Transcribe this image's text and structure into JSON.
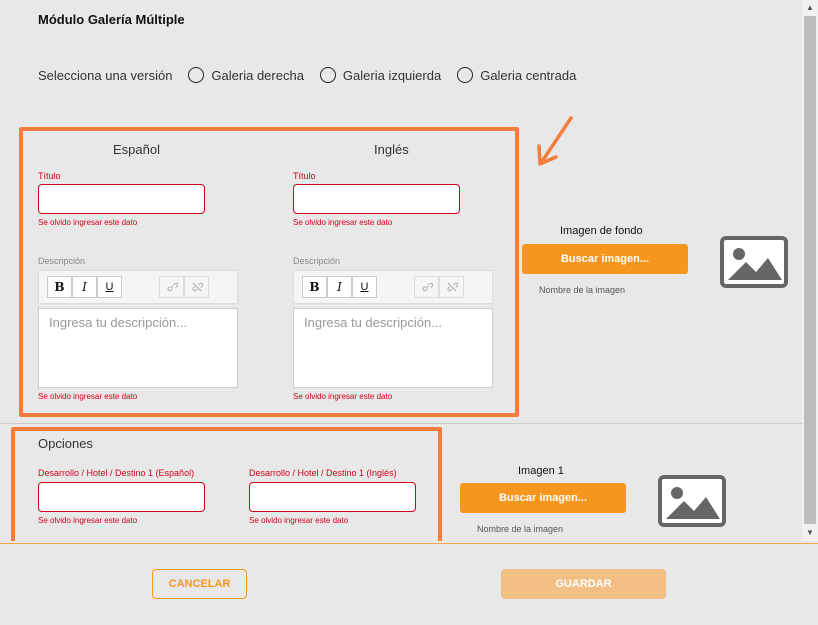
{
  "page": {
    "title": "Módulo Galería Múltiple"
  },
  "version": {
    "label": "Selecciona una versión",
    "options": [
      "Galeria derecha",
      "Galeria izquierda",
      "Galeria centrada"
    ]
  },
  "spanish": {
    "heading": "Español",
    "title_label": "Título",
    "title_error": "Se olvido ingresar este dato",
    "desc_label": "Descripción",
    "desc_placeholder": "Ingresa tu descripción...",
    "desc_error": "Se olvido ingresar este dato"
  },
  "english": {
    "heading": "Inglés",
    "title_label": "Título",
    "title_error": "Se olvido ingresar este dato",
    "desc_label": "Descripción",
    "desc_placeholder": "Ingresa tu descripción...",
    "desc_error": "Se olvido ingresar este dato"
  },
  "toolbar": {
    "bold": "B",
    "italic": "I",
    "underline": "U"
  },
  "background_image": {
    "label": "Imagen de fondo",
    "button": "Buscar imagen...",
    "name": "Nombre de la imagen"
  },
  "options": {
    "heading": "Opciones",
    "field_es_label": "Desarrollo / Hotel / Destino 1 (Español)",
    "field_en_label": "Desarrollo / Hotel / Destino 1 (Inglés)",
    "field_es_error": "Se olvido ingresar este dato",
    "field_en_error": "Se olvido ingresar este dato"
  },
  "image1": {
    "label": "Imagen 1",
    "button": "Buscar imagen...",
    "name": "Nombre de la imagen"
  },
  "footer": {
    "cancel": "CANCELAR",
    "save": "GUARDAR"
  },
  "colors": {
    "accent": "#f7961d",
    "annotation": "#f47c3c",
    "error": "#d0021b"
  }
}
